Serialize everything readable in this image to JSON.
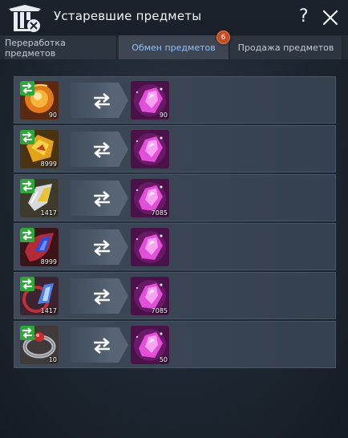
{
  "window": {
    "title": "Устаревшие предметы",
    "help_label": "?"
  },
  "tabs": [
    {
      "label": "Переработка предметов",
      "active": false
    },
    {
      "label": "Обмен предметов",
      "active": true,
      "badge": "6"
    },
    {
      "label": "Продажа предметов",
      "active": false
    }
  ],
  "colors": {
    "active_tab_text": "#8fc3ff",
    "badge": "#c94a1d",
    "swap_green": "#2fa83a",
    "gem_pink": "#e24fd8"
  },
  "exchange_rows": [
    {
      "source_item_icon": "orange-flame-orb-icon",
      "source_qty": "90",
      "result_item_icon": "pink-crystal-icon",
      "result_qty": "90"
    },
    {
      "source_item_icon": "gold-flame-crystal-icon",
      "source_qty": "8999",
      "result_item_icon": "pink-crystal-icon",
      "result_qty": ""
    },
    {
      "source_item_icon": "silver-gold-crystal-icon",
      "source_qty": "1417",
      "result_item_icon": "pink-crystal-icon",
      "result_qty": "7085"
    },
    {
      "source_item_icon": "blue-dragon-stone-icon",
      "source_qty": "8999",
      "result_item_icon": "pink-crystal-icon",
      "result_qty": ""
    },
    {
      "source_item_icon": "blue-crystal-red-ring-icon",
      "source_qty": "1417",
      "result_item_icon": "pink-crystal-icon",
      "result_qty": "7085"
    },
    {
      "source_item_icon": "silver-ring-red-gem-icon",
      "source_qty": "10",
      "result_item_icon": "pink-crystal-icon",
      "result_qty": "50"
    }
  ]
}
